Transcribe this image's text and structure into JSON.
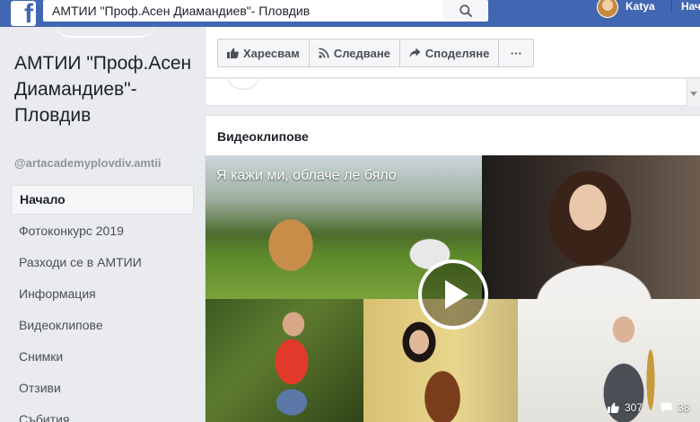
{
  "topbar": {
    "logo_letter": "f",
    "search_value": "АМТИИ \"Проф.Асен Диамандиев\"- Пловдив",
    "user_name": "Katya",
    "home_label": "Нач"
  },
  "page": {
    "title": "АМТИИ \"Проф.Асен Диамандиев\"- Пловдив",
    "handle": "@artacademyplovdiv.amtii"
  },
  "nav": {
    "items": [
      {
        "label": "Начало",
        "active": true
      },
      {
        "label": "Фотоконкурс 2019"
      },
      {
        "label": "Разходи се в АМТИИ"
      },
      {
        "label": "Информация"
      },
      {
        "label": "Видеоклипове"
      },
      {
        "label": "Снимки"
      },
      {
        "label": "Отзиви"
      },
      {
        "label": "Събития"
      }
    ]
  },
  "actions": {
    "like_label": "Харесвам",
    "follow_label": "Следване",
    "share_label": "Споделяне",
    "more_label": "···"
  },
  "strip": {
    "dots": "···"
  },
  "videos": {
    "section_title": "Видеоклипове",
    "video_title": "Я кажи ми, облаче ле бяло",
    "likes": "307",
    "comments": "38"
  },
  "colors": {
    "brand": "#4267b2",
    "page_bg": "#e9ebee"
  }
}
